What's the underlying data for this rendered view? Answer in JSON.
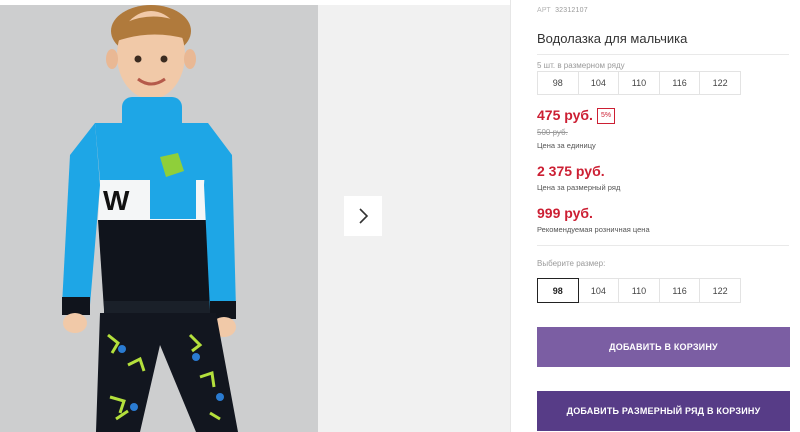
{
  "product": {
    "article_label": "АРТ",
    "article_number": "32312107",
    "title": "Водолазка для мальчика"
  },
  "size_row": {
    "label": "5 шт. в размерном ряду",
    "sizes": [
      "98",
      "104",
      "110",
      "116",
      "122"
    ]
  },
  "pricing": {
    "unit_price": "475 руб.",
    "discount_badge": "5%",
    "old_price": "500 руб.",
    "unit_caption": "Цена за единицу",
    "row_price": "2 375 руб.",
    "row_caption": "Цена за размерный ряд",
    "retail_price": "999 руб.",
    "retail_caption": "Рекомендуемая розничная цена"
  },
  "size_select": {
    "label": "Выберите размер:",
    "options": [
      "98",
      "104",
      "110",
      "116",
      "122"
    ],
    "selected": "98"
  },
  "buttons": {
    "add_to_cart": "ДОБАВИТЬ В КОРЗИНУ",
    "add_row_to_cart": "ДОБАВИТЬ РАЗМЕРНЫЙ РЯД В КОРЗИНУ"
  },
  "colors": {
    "price_red": "#cc1f33",
    "button_primary": "#7b5ea3",
    "button_dark": "#573c87",
    "shirt_blue": "#1ea6e6"
  },
  "icons": {
    "next": "chevron-right-icon"
  }
}
